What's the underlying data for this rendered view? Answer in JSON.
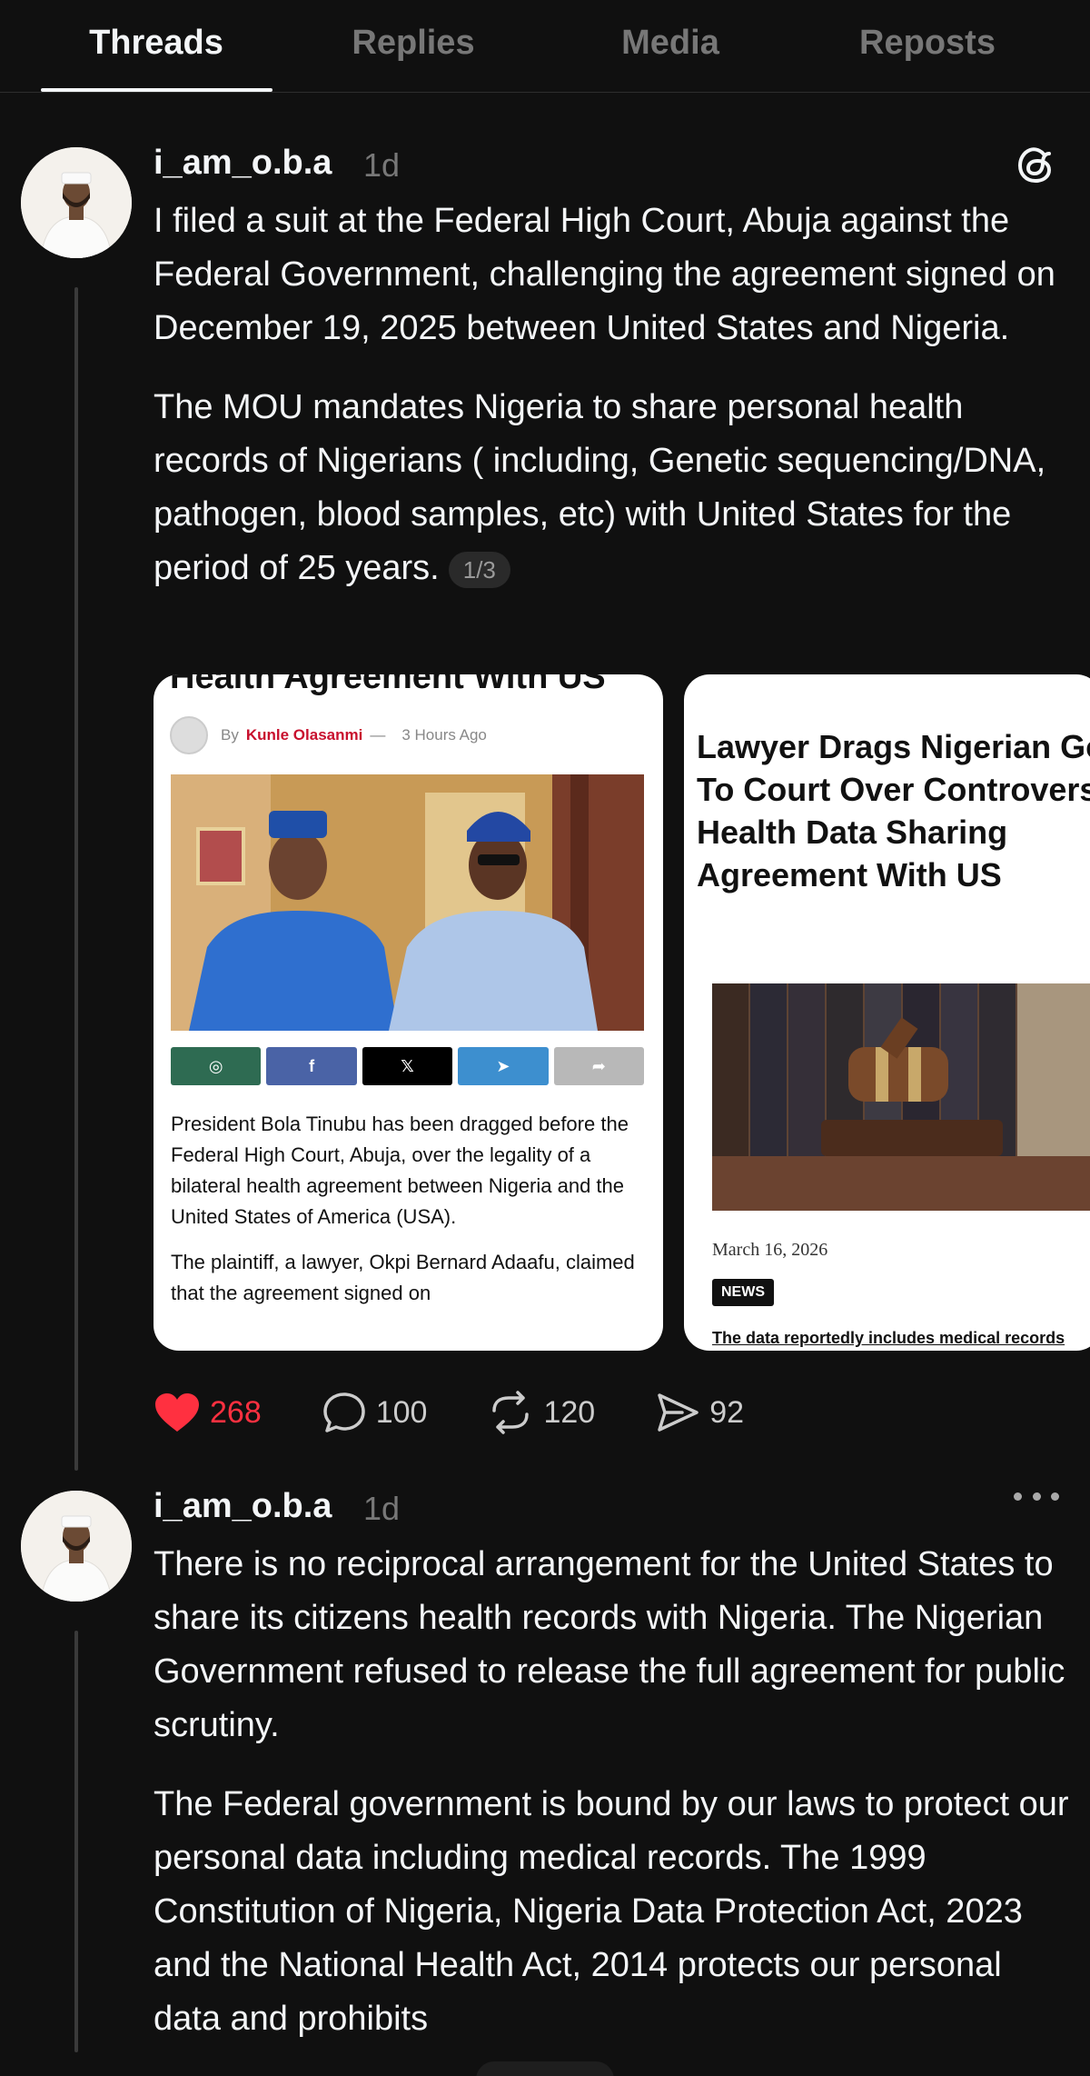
{
  "tabs": [
    {
      "label": "Threads",
      "active": true
    },
    {
      "label": "Replies",
      "active": false
    },
    {
      "label": "Media",
      "active": false
    },
    {
      "label": "Reposts",
      "active": false
    }
  ],
  "post1": {
    "username": "i_am_o.b.a",
    "time": "1d",
    "paragraphs": [
      "I filed a suit at the Federal High Court, Abuja against the Federal Government, challenging the agreement signed on December 19, 2025 between United States and Nigeria.",
      "The MOU mandates Nigeria to share personal health records of Nigerians ( including, Genetic sequencing/DNA, pathogen, blood samples, etc) with United States for the period of 25 years."
    ],
    "counter": "1/3",
    "card1": {
      "headline": "Health Agreement With US",
      "by": "By",
      "author": "Kunle Olasanmi",
      "dash": "—",
      "ago": "3 Hours Ago",
      "text": [
        "President Bola Tinubu has been dragged before the Federal High Court, Abuja, over the legality of a bilateral health agreement between Nigeria and the United States of America (USA).",
        "The plaintiff, a lawyer, Okpi Bernard Adaafu, claimed that the agreement signed on"
      ],
      "share_buttons": [
        {
          "icon": "whatsapp-icon",
          "glyph": "◎",
          "color": "#2e6b52"
        },
        {
          "icon": "facebook-icon",
          "glyph": "f",
          "color": "#4a63a6"
        },
        {
          "icon": "x-icon",
          "glyph": "𝕏",
          "color": "#000000"
        },
        {
          "icon": "telegram-icon",
          "glyph": "➤",
          "color": "#3d8fcf"
        },
        {
          "icon": "share-icon",
          "glyph": "➦",
          "color": "#b8b8b8"
        }
      ]
    },
    "card2": {
      "headline_lines": [
        "Lawyer Drags Nigerian Govt",
        "To Court Over Controversial",
        "Health Data Sharing",
        "Agreement With US"
      ],
      "date": "March 16, 2026",
      "badge": "NEWS",
      "caption": "The data reportedly includes medical records"
    },
    "actions": {
      "likes": "268",
      "replies": "100",
      "reposts": "120",
      "shares": "92"
    },
    "colors": {
      "like": "#ff3040"
    }
  },
  "post2": {
    "username": "i_am_o.b.a",
    "time": "1d",
    "paragraphs": [
      "There is no reciprocal arrangement for the United States to share its citizens health records with Nigeria. The Nigerian Government refused to release the full agreement for public scrutiny.",
      "The Federal government is bound by our laws to protect our personal data including medical records. The 1999 Constitution of Nigeria, Nigeria Data Protection Act, 2023 and the National Health Act, 2014 protects our personal data and prohibits"
    ]
  }
}
